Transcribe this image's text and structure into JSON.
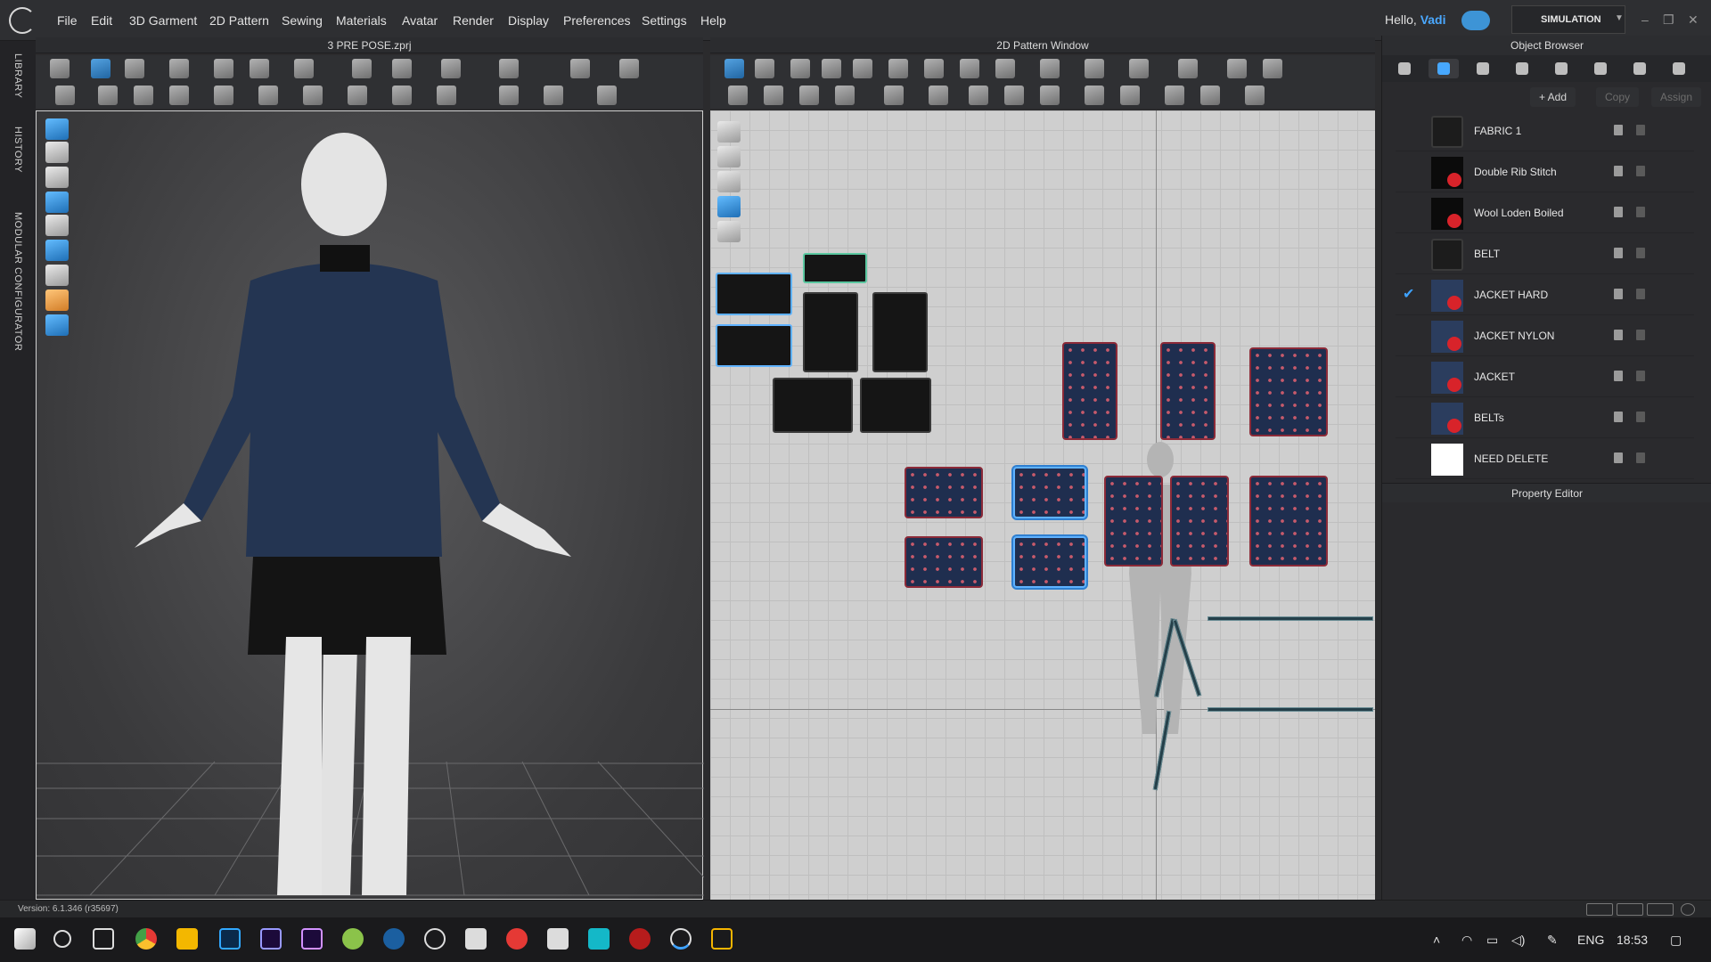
{
  "menubar": {
    "items": [
      "File",
      "Edit",
      "3D Garment",
      "2D Pattern",
      "Sewing",
      "Materials",
      "Avatar",
      "Render",
      "Display",
      "Preferences",
      "Settings",
      "Help"
    ],
    "greeting": "Hello,",
    "username": "Vadi",
    "mode_label": "SIMULATION",
    "window_controls": [
      "–",
      "❐",
      "✕"
    ]
  },
  "sidetabs": [
    "LIBRARY",
    "HISTORY",
    "MODULAR CONFIGURATOR"
  ],
  "view3d": {
    "title": "3 PRE POSE.zprj"
  },
  "view2d": {
    "title": "2D Pattern Window"
  },
  "object_browser": {
    "title": "Object Browser",
    "add_label": "+ Add",
    "copy_label": "Copy",
    "assign_label": "Assign",
    "fabrics": [
      {
        "name": "FABRIC 1",
        "swatch": "dark",
        "checked": false,
        "icon": false
      },
      {
        "name": "Double Rib Stitch",
        "swatch": "black",
        "checked": false,
        "icon": true
      },
      {
        "name": "Wool Loden Boiled",
        "swatch": "black",
        "checked": false,
        "icon": true
      },
      {
        "name": "BELT",
        "swatch": "dark",
        "checked": false,
        "icon": false
      },
      {
        "name": "JACKET HARD",
        "swatch": "navy",
        "checked": true,
        "icon": true
      },
      {
        "name": "JACKET NYLON",
        "swatch": "navy",
        "checked": false,
        "icon": true
      },
      {
        "name": "JACKET",
        "swatch": "navy",
        "checked": false,
        "icon": true
      },
      {
        "name": "BELTs",
        "swatch": "navy",
        "checked": false,
        "icon": true
      },
      {
        "name": "NEED DELETE",
        "swatch": "white",
        "checked": false,
        "icon": false
      }
    ]
  },
  "property_editor": {
    "title": "Property Editor"
  },
  "status": {
    "version": "Version: 6.1.346 (r35697)"
  },
  "taskbar": {
    "language": "ENG",
    "time": "18:53"
  },
  "colors": {
    "accent": "#3ea2ff",
    "fabric_navy": "#1f2e4f",
    "stitch_red": "#8c2a38"
  }
}
